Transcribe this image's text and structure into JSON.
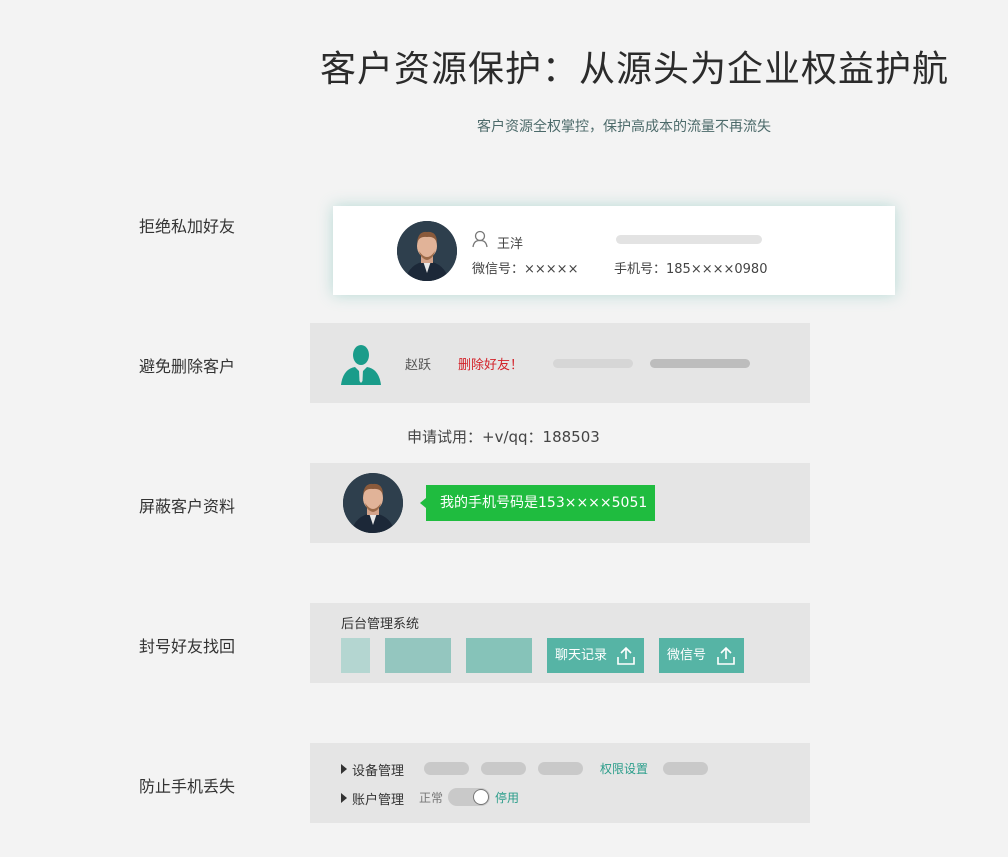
{
  "header": {
    "title": "客户资源保护：从源头为企业权益护航",
    "subtitle": "客户资源全权掌控，保护高成本的流量不再流失"
  },
  "sections": {
    "friends": {
      "label": "拒绝私加好友",
      "name": "王洋",
      "wechat": "微信号：×××××",
      "phone": "手机号：185××××0980"
    },
    "delete": {
      "label": "避免删除客户",
      "name": "赵跃",
      "warning": "删除好友！"
    },
    "trial": "申请试用：+v/qq：188503",
    "shield": {
      "label": "屏蔽客户资料",
      "message": "我的手机号码是153××××5051"
    },
    "recover": {
      "label": "封号好友找回",
      "system_title": "后台管理系统",
      "chat_button": "聊天记录",
      "wechat_button": "微信号"
    },
    "lost": {
      "label": "防止手机丢失",
      "device": "设备管理",
      "permission": "权限设置",
      "account": "账户管理",
      "status_normal": "正常",
      "status_stop": "停用"
    }
  },
  "colors": {
    "accent": "#56b4a5",
    "chat_green": "#1fbc3f",
    "warning_red": "#d3232a",
    "page_bg": "#f3f3f3",
    "panel_bg": "#e5e5e5"
  },
  "icons": [
    "user-outline-icon",
    "user-silhouette-icon",
    "upload-icon",
    "triangle-right-icon"
  ]
}
